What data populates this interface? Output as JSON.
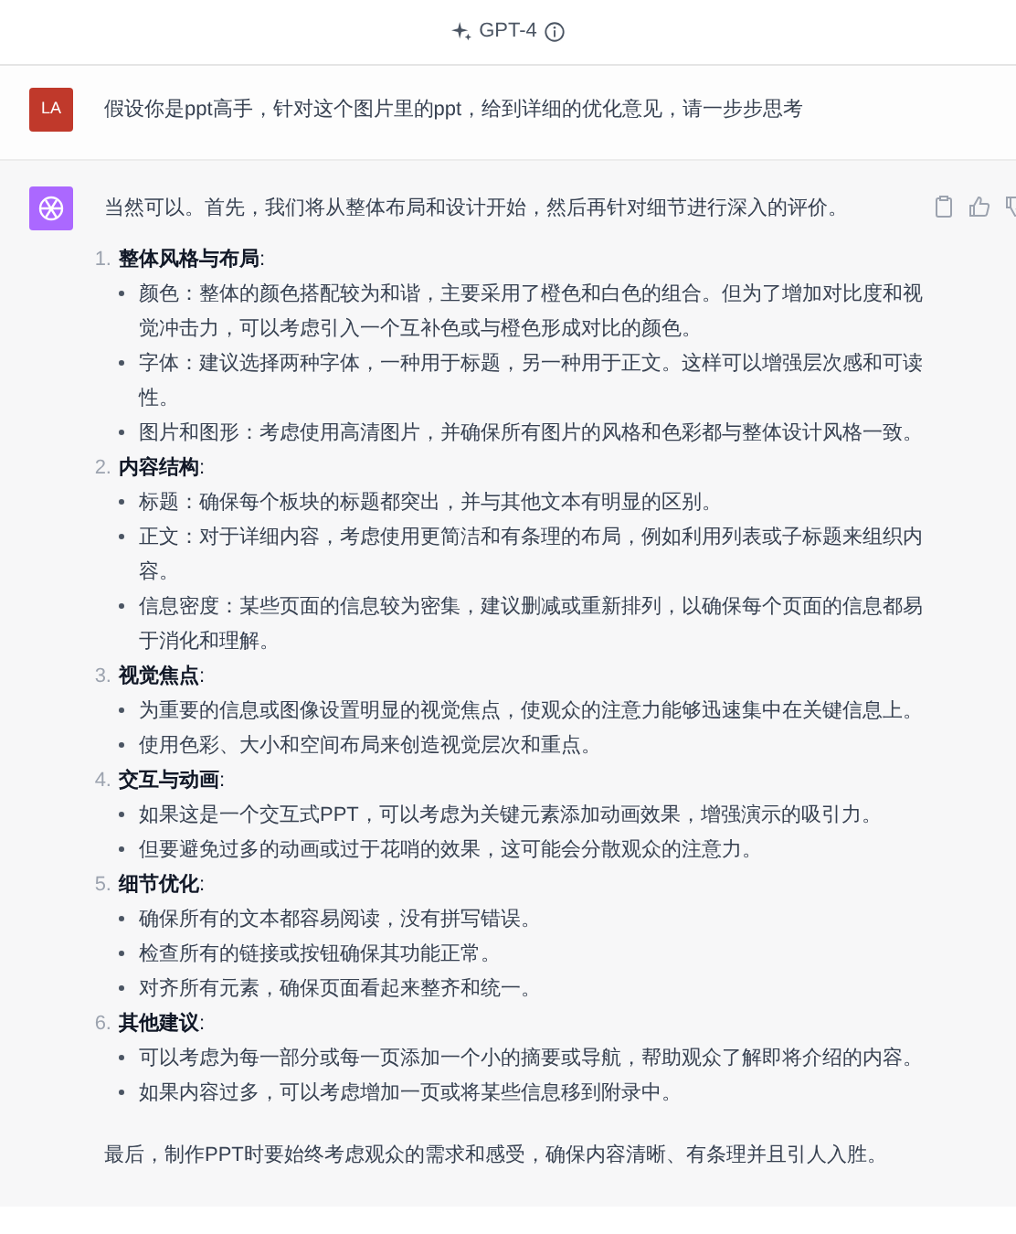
{
  "header": {
    "title": "GPT-4"
  },
  "user_message": {
    "avatar": "LA",
    "text": "假设你是ppt高手，针对这个图片里的ppt，给到详细的优化意见，请一步步思考"
  },
  "assistant_message": {
    "intro": "当然可以。首先，我们将从整体布局和设计开始，然后再针对细节进行深入的评价。",
    "sections": [
      {
        "number": "1.",
        "title": "**整体风格与布局**:",
        "items": [
          "颜色：整体的颜色搭配较为和谐，主要采用了橙色和白色的组合。但为了增加对比度和视觉冲击力，可以考虑引入一个互补色或与橙色形成对比的颜色。",
          "字体：建议选择两种字体，一种用于标题，另一种用于正文。这样可以增强层次感和可读性。",
          "图片和图形：考虑使用高清图片，并确保所有图片的风格和色彩都与整体设计风格一致。"
        ]
      },
      {
        "number": "2.",
        "title": "**内容结构**:",
        "items": [
          "标题：确保每个板块的标题都突出，并与其他文本有明显的区别。",
          "正文：对于详细内容，考虑使用更简洁和有条理的布局，例如利用列表或子标题来组织内容。",
          "信息密度：某些页面的信息较为密集，建议删减或重新排列，以确保每个页面的信息都易于消化和理解。"
        ]
      },
      {
        "number": "3.",
        "title": "**视觉焦点**:",
        "items": [
          "为重要的信息或图像设置明显的视觉焦点，使观众的注意力能够迅速集中在关键信息上。",
          "使用色彩、大小和空间布局来创造视觉层次和重点。"
        ]
      },
      {
        "number": "4.",
        "title": "**交互与动画**:",
        "items": [
          "如果这是一个交互式PPT，可以考虑为关键元素添加动画效果，增强演示的吸引力。",
          "但要避免过多的动画或过于花哨的效果，这可能会分散观众的注意力。"
        ]
      },
      {
        "number": "5.",
        "title": "**细节优化**:",
        "items": [
          "确保所有的文本都容易阅读，没有拼写错误。",
          "检查所有的链接或按钮确保其功能正常。",
          "对齐所有元素，确保页面看起来整齐和统一。"
        ]
      },
      {
        "number": "6.",
        "title": "**其他建议**:",
        "items": [
          "可以考虑为每一部分或每一页添加一个小的摘要或导航，帮助观众了解即将介绍的内容。",
          "如果内容过多，可以考虑增加一页或将某些信息移到附录中。"
        ]
      }
    ],
    "conclusion": "最后，制作PPT时要始终考虑观众的需求和感受，确保内容清晰、有条理并且引人入胜。"
  }
}
